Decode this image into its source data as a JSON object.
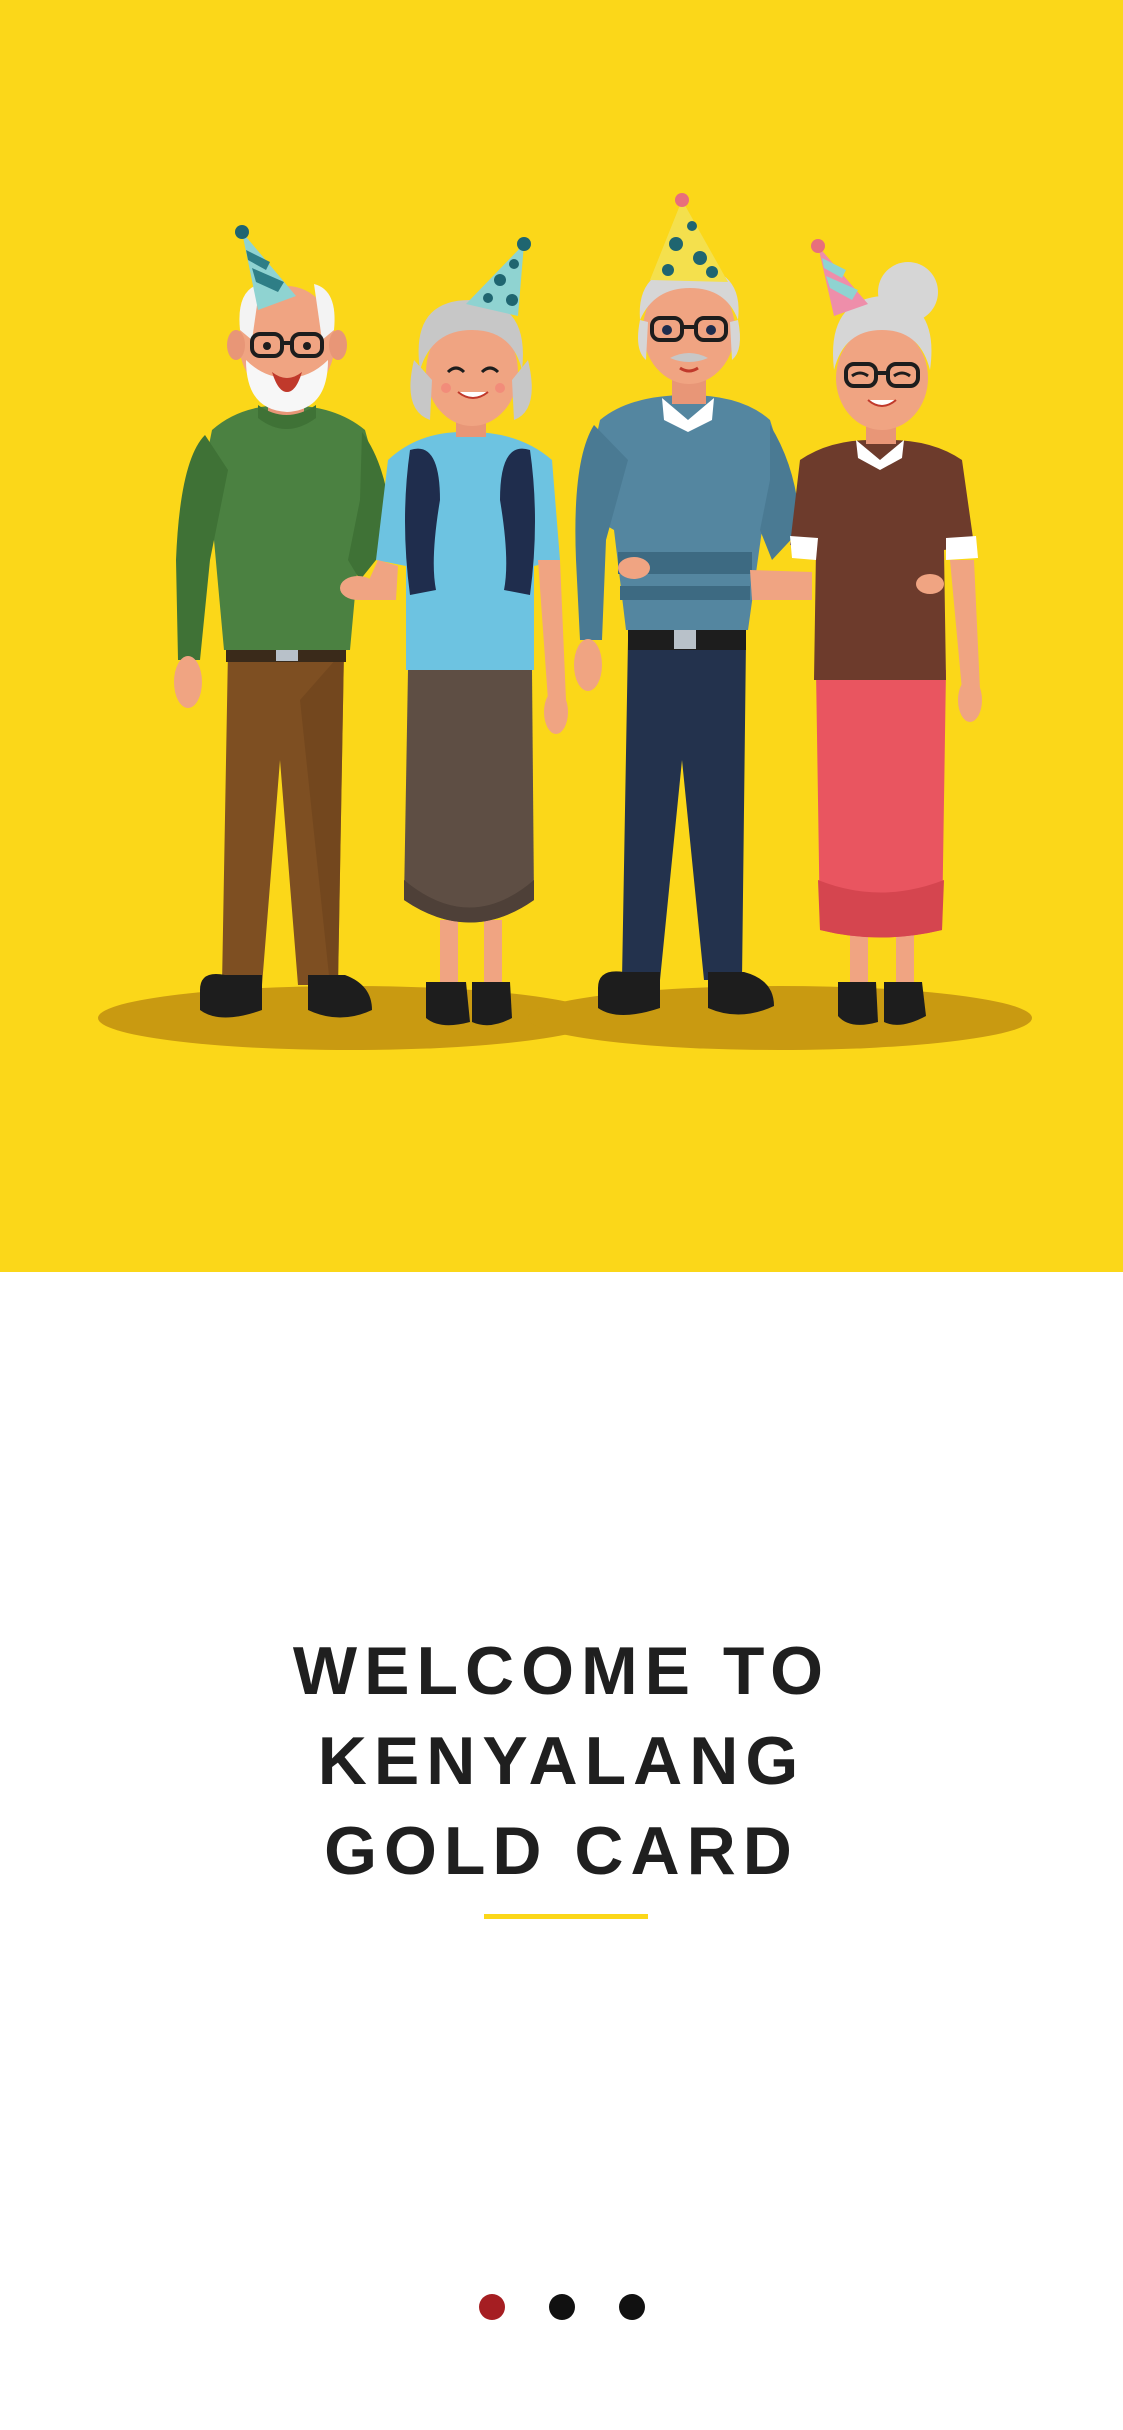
{
  "onboarding": {
    "title_lines": [
      "WELCOME TO",
      "KENYALANG",
      "GOLD CARD"
    ],
    "active_page_index": 0,
    "page_count": 3
  },
  "colors": {
    "hero_background": "#FBD719",
    "title_text": "#1f1f1f",
    "divider": "#FBD719",
    "dot_active": "#A51E22",
    "dot_inactive": "#111111"
  },
  "illustration": {
    "description_icon": "elderly-group-party-hats-illustration"
  }
}
